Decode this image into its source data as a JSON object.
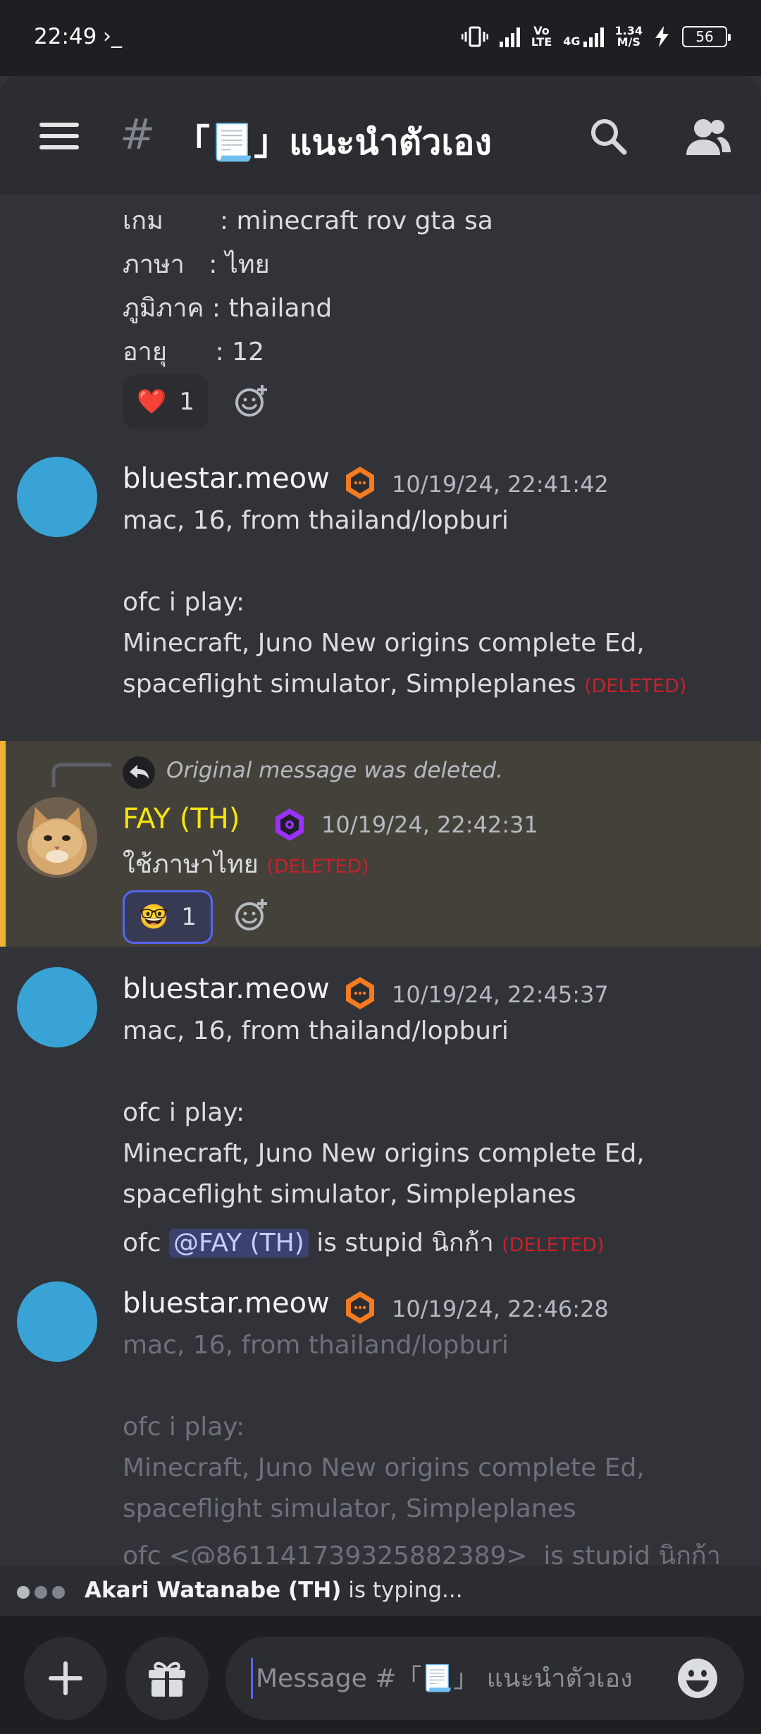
{
  "status": {
    "time": "22:49",
    "prompt": "›_",
    "net1": "Vo\nLTE",
    "net2": "4G",
    "speed": "1.34\nM/S",
    "battery": "56"
  },
  "header": {
    "channel_title": "「📃」แนะนำตัวเอง"
  },
  "top_message": {
    "lines": [
      "เกม       : minecraft rov gta sa",
      "ภาษา   : ไทย",
      "ภูมิภาค : thailand",
      "อายุ      : 12"
    ],
    "reaction": {
      "emoji": "❤️",
      "count": "1"
    }
  },
  "messages": [
    {
      "username": "bluestar.meow",
      "timestamp": "10/19/24, 22:41:42",
      "lines": [
        "mac, 16, from thailand/lopburi",
        "",
        "ofc i play:",
        "Minecraft, Juno New origins complete Ed,",
        "spaceflight simulator, Simpleplanes"
      ],
      "deleted_tag": "(DELETED)"
    },
    {
      "reply_note": "Original message was deleted.",
      "username": "FAY (TH)",
      "timestamp": "10/19/24, 22:42:31",
      "text": "ใช้ภาษาไทย",
      "deleted_tag": "(DELETED)",
      "reaction": {
        "emoji": "🤓",
        "count": "1"
      }
    },
    {
      "username": "bluestar.meow",
      "timestamp": "10/19/24, 22:45:37",
      "lines": [
        "mac, 16, from thailand/lopburi",
        "",
        "ofc i play:",
        "Minecraft, Juno New origins complete Ed,",
        "spaceflight simulator, Simpleplanes"
      ],
      "last_prefix": "ofc",
      "mention": "@FAY (TH)",
      "last_suffix": " is stupid นิกก้า",
      "deleted_tag": "(DELETED)"
    },
    {
      "username": "bluestar.meow",
      "timestamp": "10/19/24, 22:46:28",
      "lines": [
        "mac, 16, from thailand/lopburi",
        "",
        "ofc i play:",
        "Minecraft, Juno New origins complete Ed,",
        "spaceflight simulator, Simpleplanes",
        "ofc <@861141739325882389>  is stupid นิกก้า"
      ]
    }
  ],
  "typing": {
    "user": "Akari Watanabe (TH)",
    "suffix": " is typing..."
  },
  "composer": {
    "placeholder": "Message #「📃」 แนะนำตัวเอง"
  },
  "colors": {
    "accent": "#5865f2",
    "deleted": "#c9212b",
    "highlight_bar": "#f0b232",
    "fay_name": "#f5e50c",
    "avatar": "#3aa3d6"
  }
}
